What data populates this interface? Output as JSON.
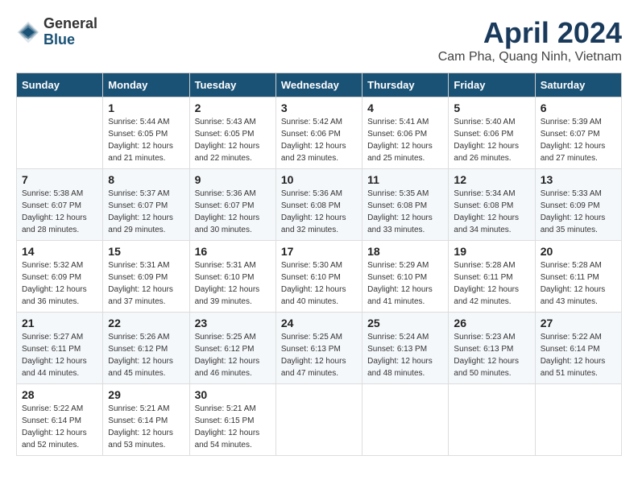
{
  "header": {
    "logo_general": "General",
    "logo_blue": "Blue",
    "month_title": "April 2024",
    "location": "Cam Pha, Quang Ninh, Vietnam"
  },
  "calendar": {
    "weekdays": [
      "Sunday",
      "Monday",
      "Tuesday",
      "Wednesday",
      "Thursday",
      "Friday",
      "Saturday"
    ],
    "weeks": [
      [
        {
          "day": "",
          "sunrise": "",
          "sunset": "",
          "daylight": ""
        },
        {
          "day": "1",
          "sunrise": "Sunrise: 5:44 AM",
          "sunset": "Sunset: 6:05 PM",
          "daylight": "Daylight: 12 hours and 21 minutes."
        },
        {
          "day": "2",
          "sunrise": "Sunrise: 5:43 AM",
          "sunset": "Sunset: 6:05 PM",
          "daylight": "Daylight: 12 hours and 22 minutes."
        },
        {
          "day": "3",
          "sunrise": "Sunrise: 5:42 AM",
          "sunset": "Sunset: 6:06 PM",
          "daylight": "Daylight: 12 hours and 23 minutes."
        },
        {
          "day": "4",
          "sunrise": "Sunrise: 5:41 AM",
          "sunset": "Sunset: 6:06 PM",
          "daylight": "Daylight: 12 hours and 25 minutes."
        },
        {
          "day": "5",
          "sunrise": "Sunrise: 5:40 AM",
          "sunset": "Sunset: 6:06 PM",
          "daylight": "Daylight: 12 hours and 26 minutes."
        },
        {
          "day": "6",
          "sunrise": "Sunrise: 5:39 AM",
          "sunset": "Sunset: 6:07 PM",
          "daylight": "Daylight: 12 hours and 27 minutes."
        }
      ],
      [
        {
          "day": "7",
          "sunrise": "Sunrise: 5:38 AM",
          "sunset": "Sunset: 6:07 PM",
          "daylight": "Daylight: 12 hours and 28 minutes."
        },
        {
          "day": "8",
          "sunrise": "Sunrise: 5:37 AM",
          "sunset": "Sunset: 6:07 PM",
          "daylight": "Daylight: 12 hours and 29 minutes."
        },
        {
          "day": "9",
          "sunrise": "Sunrise: 5:36 AM",
          "sunset": "Sunset: 6:07 PM",
          "daylight": "Daylight: 12 hours and 30 minutes."
        },
        {
          "day": "10",
          "sunrise": "Sunrise: 5:36 AM",
          "sunset": "Sunset: 6:08 PM",
          "daylight": "Daylight: 12 hours and 32 minutes."
        },
        {
          "day": "11",
          "sunrise": "Sunrise: 5:35 AM",
          "sunset": "Sunset: 6:08 PM",
          "daylight": "Daylight: 12 hours and 33 minutes."
        },
        {
          "day": "12",
          "sunrise": "Sunrise: 5:34 AM",
          "sunset": "Sunset: 6:08 PM",
          "daylight": "Daylight: 12 hours and 34 minutes."
        },
        {
          "day": "13",
          "sunrise": "Sunrise: 5:33 AM",
          "sunset": "Sunset: 6:09 PM",
          "daylight": "Daylight: 12 hours and 35 minutes."
        }
      ],
      [
        {
          "day": "14",
          "sunrise": "Sunrise: 5:32 AM",
          "sunset": "Sunset: 6:09 PM",
          "daylight": "Daylight: 12 hours and 36 minutes."
        },
        {
          "day": "15",
          "sunrise": "Sunrise: 5:31 AM",
          "sunset": "Sunset: 6:09 PM",
          "daylight": "Daylight: 12 hours and 37 minutes."
        },
        {
          "day": "16",
          "sunrise": "Sunrise: 5:31 AM",
          "sunset": "Sunset: 6:10 PM",
          "daylight": "Daylight: 12 hours and 39 minutes."
        },
        {
          "day": "17",
          "sunrise": "Sunrise: 5:30 AM",
          "sunset": "Sunset: 6:10 PM",
          "daylight": "Daylight: 12 hours and 40 minutes."
        },
        {
          "day": "18",
          "sunrise": "Sunrise: 5:29 AM",
          "sunset": "Sunset: 6:10 PM",
          "daylight": "Daylight: 12 hours and 41 minutes."
        },
        {
          "day": "19",
          "sunrise": "Sunrise: 5:28 AM",
          "sunset": "Sunset: 6:11 PM",
          "daylight": "Daylight: 12 hours and 42 minutes."
        },
        {
          "day": "20",
          "sunrise": "Sunrise: 5:28 AM",
          "sunset": "Sunset: 6:11 PM",
          "daylight": "Daylight: 12 hours and 43 minutes."
        }
      ],
      [
        {
          "day": "21",
          "sunrise": "Sunrise: 5:27 AM",
          "sunset": "Sunset: 6:11 PM",
          "daylight": "Daylight: 12 hours and 44 minutes."
        },
        {
          "day": "22",
          "sunrise": "Sunrise: 5:26 AM",
          "sunset": "Sunset: 6:12 PM",
          "daylight": "Daylight: 12 hours and 45 minutes."
        },
        {
          "day": "23",
          "sunrise": "Sunrise: 5:25 AM",
          "sunset": "Sunset: 6:12 PM",
          "daylight": "Daylight: 12 hours and 46 minutes."
        },
        {
          "day": "24",
          "sunrise": "Sunrise: 5:25 AM",
          "sunset": "Sunset: 6:13 PM",
          "daylight": "Daylight: 12 hours and 47 minutes."
        },
        {
          "day": "25",
          "sunrise": "Sunrise: 5:24 AM",
          "sunset": "Sunset: 6:13 PM",
          "daylight": "Daylight: 12 hours and 48 minutes."
        },
        {
          "day": "26",
          "sunrise": "Sunrise: 5:23 AM",
          "sunset": "Sunset: 6:13 PM",
          "daylight": "Daylight: 12 hours and 50 minutes."
        },
        {
          "day": "27",
          "sunrise": "Sunrise: 5:22 AM",
          "sunset": "Sunset: 6:14 PM",
          "daylight": "Daylight: 12 hours and 51 minutes."
        }
      ],
      [
        {
          "day": "28",
          "sunrise": "Sunrise: 5:22 AM",
          "sunset": "Sunset: 6:14 PM",
          "daylight": "Daylight: 12 hours and 52 minutes."
        },
        {
          "day": "29",
          "sunrise": "Sunrise: 5:21 AM",
          "sunset": "Sunset: 6:14 PM",
          "daylight": "Daylight: 12 hours and 53 minutes."
        },
        {
          "day": "30",
          "sunrise": "Sunrise: 5:21 AM",
          "sunset": "Sunset: 6:15 PM",
          "daylight": "Daylight: 12 hours and 54 minutes."
        },
        {
          "day": "",
          "sunrise": "",
          "sunset": "",
          "daylight": ""
        },
        {
          "day": "",
          "sunrise": "",
          "sunset": "",
          "daylight": ""
        },
        {
          "day": "",
          "sunrise": "",
          "sunset": "",
          "daylight": ""
        },
        {
          "day": "",
          "sunrise": "",
          "sunset": "",
          "daylight": ""
        }
      ]
    ]
  }
}
